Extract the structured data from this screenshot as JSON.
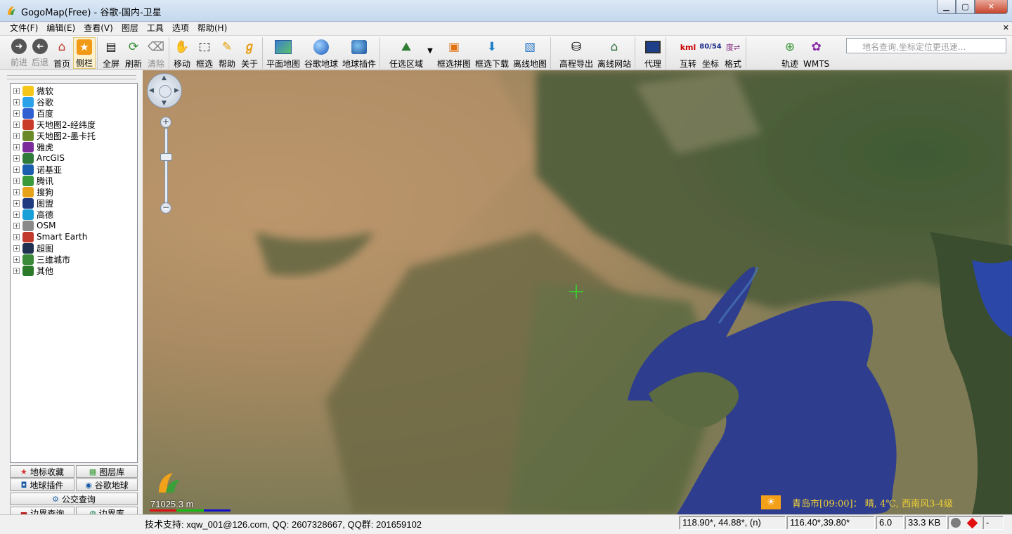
{
  "window": {
    "title": "GogoMap(Free) - 谷歌-国内-卫星",
    "min": "0",
    "max": "1",
    "close": "r"
  },
  "menu": [
    "文件(F)",
    "编辑(E)",
    "查看(V)",
    "图层",
    "工具",
    "选项",
    "帮助(H)"
  ],
  "menu_close": "x",
  "toolbar": {
    "nav": [
      {
        "label": "前进",
        "icon": "forward-icon",
        "disabled": true
      },
      {
        "label": "后退",
        "icon": "back-icon",
        "disabled": true
      },
      {
        "label": "首页",
        "icon": "home-icon"
      },
      {
        "label": "侧栏",
        "icon": "star-icon",
        "active": true
      }
    ],
    "view": [
      {
        "label": "全屏",
        "icon": "fullscreen-icon"
      },
      {
        "label": "刷新",
        "icon": "refresh-icon"
      },
      {
        "label": "清除",
        "icon": "broom-icon",
        "disabled": true
      }
    ],
    "tools": [
      {
        "label": "移动",
        "icon": "hand-icon"
      },
      {
        "label": "框选",
        "icon": "select-box-icon"
      },
      {
        "label": "帮助",
        "icon": "help-icon"
      },
      {
        "label": "关于",
        "icon": "about-icon"
      }
    ],
    "maps": [
      {
        "label": "平面地图",
        "icon": "flat-map-icon"
      },
      {
        "label": "谷歌地球",
        "icon": "google-earth-icon"
      },
      {
        "label": "地球插件",
        "icon": "earth-plugin-icon"
      }
    ],
    "region": [
      {
        "label": "任选区域",
        "icon": "region-icon"
      },
      {
        "label": "框选拼图",
        "icon": "stitch-icon"
      },
      {
        "label": "框选下载",
        "icon": "download-icon"
      },
      {
        "label": "离线地图",
        "icon": "offline-map-icon"
      }
    ],
    "export": [
      {
        "label": "高程导出",
        "icon": "elevation-icon"
      },
      {
        "label": "离线网站",
        "icon": "offline-site-icon"
      }
    ],
    "proxy": [
      {
        "label": "代理",
        "icon": "monitor-icon"
      }
    ],
    "convert": [
      {
        "label": "互转",
        "icon": "kml-xls-icon",
        "ic": "kml"
      },
      {
        "label": "坐标",
        "icon": "coordinate-icon",
        "ic": "80/54"
      },
      {
        "label": "格式",
        "icon": "format-icon",
        "ic": "度⇌"
      }
    ],
    "extra": [
      {
        "label": "轨迹",
        "icon": "track-icon"
      },
      {
        "label": "WMTS",
        "icon": "wmts-icon"
      }
    ],
    "search_placeholder": "地名查询,坐标定位更迅速..."
  },
  "tree": [
    {
      "label": "微软",
      "icon": "microsoft-icon",
      "color": "#f5c518"
    },
    {
      "label": "谷歌",
      "icon": "google-icon",
      "color": "#2aa1e8"
    },
    {
      "label": "百度",
      "icon": "baidu-icon",
      "color": "#2f5fd0"
    },
    {
      "label": "天地图2-经纬度",
      "icon": "tianditu-icon",
      "color": "#c93a2a"
    },
    {
      "label": "天地图2-墨卡托",
      "icon": "tianditu-mercator-icon",
      "color": "#6a8a2a"
    },
    {
      "label": "雅虎",
      "icon": "yahoo-icon",
      "color": "#7b2c9a"
    },
    {
      "label": "ArcGIS",
      "icon": "arcgis-icon",
      "color": "#2d7a3a"
    },
    {
      "label": "诺基亚",
      "icon": "nokia-icon",
      "color": "#1b5eb0"
    },
    {
      "label": "腾讯",
      "icon": "tencent-icon",
      "color": "#3a9a3a"
    },
    {
      "label": "搜狗",
      "icon": "sogou-icon",
      "color": "#e8a21a"
    },
    {
      "label": "图盟",
      "icon": "tumeng-icon",
      "color": "#203a80"
    },
    {
      "label": "高德",
      "icon": "gaode-icon",
      "color": "#19a0d8"
    },
    {
      "label": "OSM",
      "icon": "osm-icon",
      "color": "#8a8a8a"
    },
    {
      "label": "Smart Earth",
      "icon": "smart-earth-icon",
      "color": "#c0392b"
    },
    {
      "label": "超图",
      "icon": "supermap-icon",
      "color": "#203050"
    },
    {
      "label": "三维城市",
      "icon": "3d-city-icon",
      "color": "#3a8a3a"
    },
    {
      "label": "其他",
      "icon": "other-icon",
      "color": "#2a7a2a"
    }
  ],
  "bottom_tabs": {
    "landmarks": "地标收藏",
    "layers": "图层库",
    "earth_plugin": "地球插件",
    "google_earth": "谷歌地球",
    "bus": "公交查询",
    "border_query": "边界查询",
    "border_lib": "边界库"
  },
  "map": {
    "scale": "71025.3 m",
    "weather": "青岛市[09:00]： 晴, 4℃, 西南风3-4级",
    "zoom_level_fraction": 0.64
  },
  "status": {
    "support": "技术支持: xqw_001@126.com, QQ: 2607328667, QQ群: 201659102",
    "cursor": "118.90*, 44.88*, (n)",
    "center": "116.40*,39.80*",
    "zoom": "6.0",
    "size": "33.3 KB",
    "tail": "-"
  },
  "colors": {
    "weather_text": "#f2d233",
    "weather_icon_bg": "#f5a019",
    "sea": "#2f3f8f"
  }
}
